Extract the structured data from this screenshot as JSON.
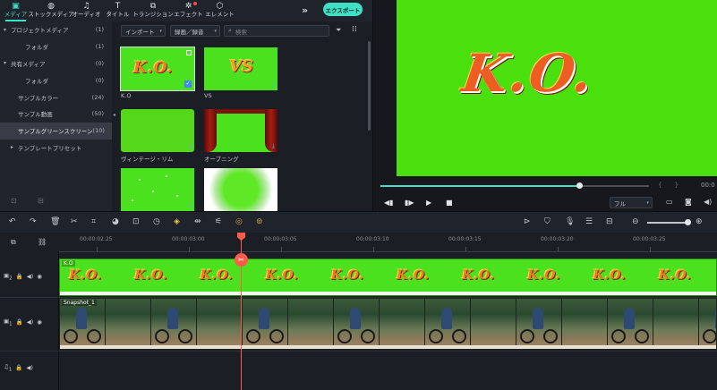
{
  "toolbar": {
    "tabs": [
      {
        "label": "メディア",
        "icon": "▣"
      },
      {
        "label": "ストックメディア",
        "icon": "◍"
      },
      {
        "label": "オーディオ",
        "icon": "♫"
      },
      {
        "label": "タイトル",
        "icon": "T"
      },
      {
        "label": "トランジション",
        "icon": "⧉"
      },
      {
        "label": "エフェクト",
        "icon": "✲"
      },
      {
        "label": "エレメント",
        "icon": "⬡"
      }
    ],
    "more": "»",
    "export_label": "エクスポート"
  },
  "tree": {
    "items": [
      {
        "arrow": "▾",
        "label": "プロジェクトメディア",
        "count": "(1)"
      },
      {
        "arrow": "",
        "label": "フォルダ",
        "count": "(1)"
      },
      {
        "arrow": "▾",
        "label": "共有メディア",
        "count": "(0)"
      },
      {
        "arrow": "",
        "label": "フォルダ",
        "count": "(0)"
      },
      {
        "arrow": "",
        "label": "サンプルカラー",
        "count": "(24)"
      },
      {
        "arrow": "",
        "label": "サンプル動画",
        "count": "(50)"
      },
      {
        "arrow": "",
        "label": "サンプルグリーンスクリーン",
        "count": "(10)"
      },
      {
        "arrow": "▸",
        "label": "テンプレートプリセット",
        "count": ""
      }
    ]
  },
  "media": {
    "import_label": "インポート",
    "record_label": "録画／録音",
    "search_placeholder": "検索",
    "thumbs": [
      {
        "caption": "K.O",
        "art": "K.O."
      },
      {
        "caption": "VS",
        "art": "VS"
      },
      {
        "caption": "ヴィンテージ・リム",
        "art": ""
      },
      {
        "caption": "オープニング",
        "art": ""
      },
      {
        "caption": "",
        "art": ""
      },
      {
        "caption": "",
        "art": ""
      }
    ]
  },
  "preview": {
    "art_text": "K.O.",
    "progress": 0.74,
    "brackets": "{ }",
    "time_stub": "00:0",
    "quality_label": "フル"
  },
  "timeline": {
    "ticks": [
      "00:00:02:25",
      "00:00:03:00",
      "00:00:03:05",
      "00:00:03:10",
      "00:00:03:15",
      "00:00:03:20",
      "00:00:03:25"
    ],
    "tracks": [
      {
        "num": "2",
        "clip_title": "K.O"
      },
      {
        "num": "1",
        "clip_title": "Snapshot_1"
      },
      {
        "num": "1",
        "clip_title": ""
      }
    ],
    "ko_repeat": "K.O. K.O. K.O. K.O. K.O. K.O. K.O. K.O. K.O. K.O. K.O. K.O."
  }
}
